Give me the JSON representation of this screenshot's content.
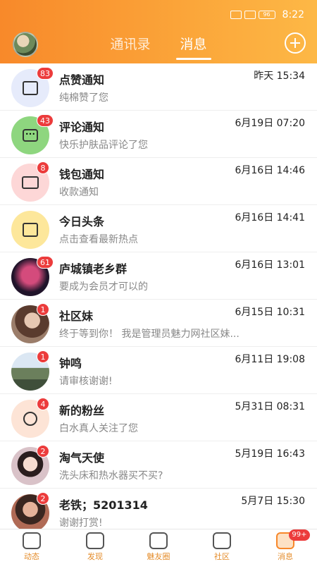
{
  "status_bar": {
    "time": "8:22",
    "battery": "96"
  },
  "header": {
    "tabs": [
      "通讯录",
      "消息"
    ],
    "active_tab": 1
  },
  "messages": [
    {
      "name": "点赞通知",
      "sub": "纯棉赞了您",
      "time": "昨天 15:34",
      "badge": "83",
      "avatar": "like-icon",
      "color": "#e6ebfb"
    },
    {
      "name": "评论通知",
      "sub": "快乐护肤品评论了您",
      "time": "6月19日 07:20",
      "badge": "43",
      "avatar": "comment-icon",
      "color": "#8ed67f"
    },
    {
      "name": "钱包通知",
      "sub": "收款通知",
      "time": "6月16日 14:46",
      "badge": "8",
      "avatar": "wallet-icon",
      "color": "#fdd7d7"
    },
    {
      "name": "今日头条",
      "sub": "点击查看最新热点",
      "time": "6月16日 14:41",
      "badge": "",
      "avatar": "news-icon",
      "color": "#fde79b"
    },
    {
      "name": "庐城镇老乡群",
      "sub": "要成为会员才可以的",
      "time": "6月16日 13:01",
      "badge": "61",
      "avatar": "group-avatar",
      "color": "#20142a"
    },
    {
      "name": "社区妹",
      "sub": "终于等到你！  我是管理员魅力网社区妹...",
      "time": "6月15日 10:31",
      "badge": "1",
      "avatar": "user-avatar",
      "color": "#9b7d6a"
    },
    {
      "name": "钟鸣",
      "sub": "请审核谢谢!",
      "time": "6月11日 19:08",
      "badge": "1",
      "avatar": "user-avatar",
      "color": "#7a9bb5"
    },
    {
      "name": "新的粉丝",
      "sub": "白水真人关注了您",
      "time": "5月31日 08:31",
      "badge": "4",
      "avatar": "fans-icon",
      "color": "#fde4d6"
    },
    {
      "name": "淘气天使",
      "sub": "洗头床和热水器买不买?",
      "time": "5月19日 16:43",
      "badge": "2",
      "avatar": "user-avatar",
      "color": "#d9c2c8"
    },
    {
      "name": "老铁；5201314",
      "sub": "谢谢打赏!",
      "time": "5月7日 15:30",
      "badge": "2",
      "avatar": "user-avatar",
      "color": "#b06a55"
    }
  ],
  "bottom_nav": [
    {
      "label": "动态"
    },
    {
      "label": "发现"
    },
    {
      "label": "魅友圈"
    },
    {
      "label": "社区"
    },
    {
      "label": "消息",
      "badge": "99+",
      "active": true
    }
  ]
}
